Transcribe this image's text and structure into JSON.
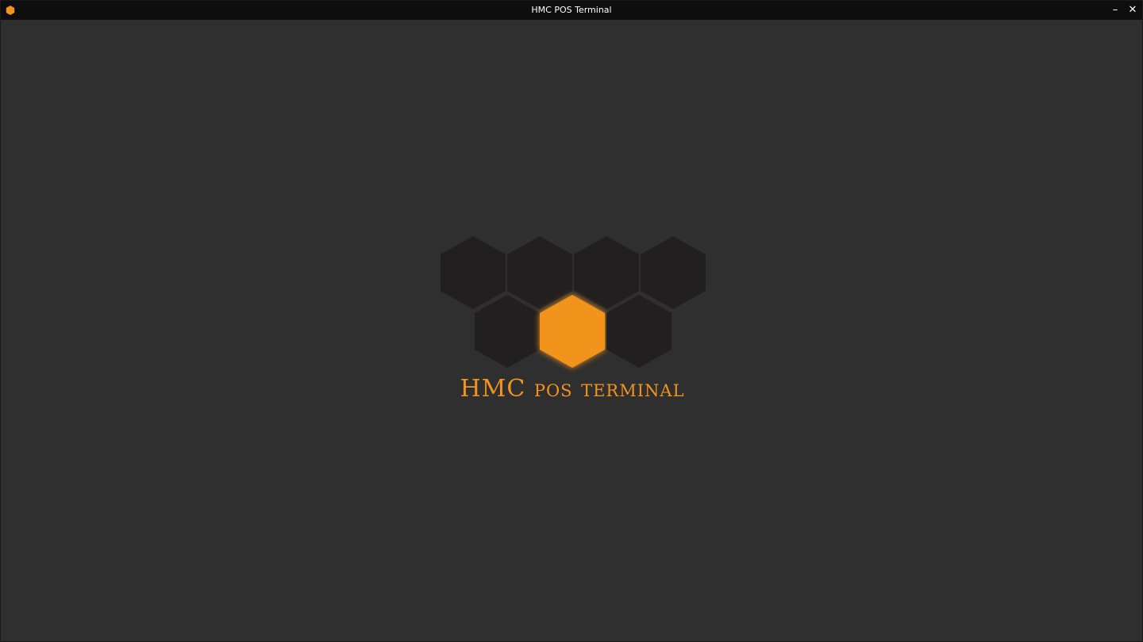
{
  "window": {
    "title": "HMC POS Terminal",
    "minimize_label": "–",
    "close_label": "✕",
    "icon": "hexagon-app-icon"
  },
  "splash": {
    "logo_text": "HMC pos terminal",
    "logo_icon": "honeycomb-logo",
    "accent_color": "#f2931f",
    "hex_color": "#221f20",
    "background_color": "#2f2f2f"
  }
}
